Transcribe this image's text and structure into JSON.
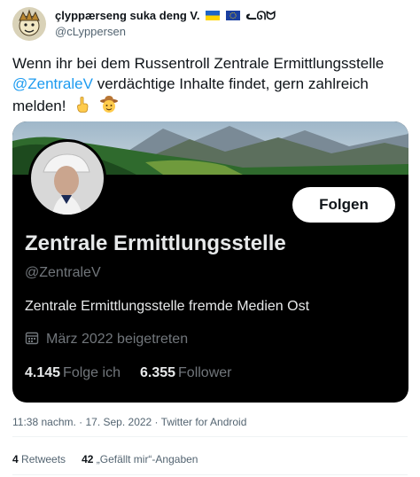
{
  "author": {
    "display_name": "çlyppærseng suka deng V.",
    "name_suffix": "ᓚᘏᗢ",
    "username": "@cLyppersen"
  },
  "tweet": {
    "text_before_mention": "Wenn ihr bei dem Russentroll Zentrale Ermittlungsstelle ",
    "mention": "@ZentraleV",
    "text_after_mention": " verdächtige Inhalte findet, gern zahlreich melden!",
    "emojis": [
      "pointing-up-icon",
      "cowboy-face-icon"
    ]
  },
  "profile_card": {
    "title": "Zentrale Ermittlungsstelle",
    "handle": "@ZentraleV",
    "bio": "Zentrale Ermittlungsstelle fremde Medien Ost",
    "joined": "März 2022 beigetreten",
    "following_count": "4.145",
    "following_label": "Folge ich",
    "followers_count": "6.355",
    "followers_label": "Follower",
    "follow_button": "Folgen"
  },
  "meta": {
    "timestamp": "11:38 nachm. · 17. Sep. 2022 · Twitter for Android"
  },
  "engagement": {
    "retweets_count": "4",
    "retweets_label": "Retweets",
    "likes_count": "42",
    "likes_label": "„Gefällt mir“-Angaben"
  },
  "colors": {
    "link": "#1d9bf0",
    "card_background": "#000000",
    "muted_text": "#536471"
  }
}
